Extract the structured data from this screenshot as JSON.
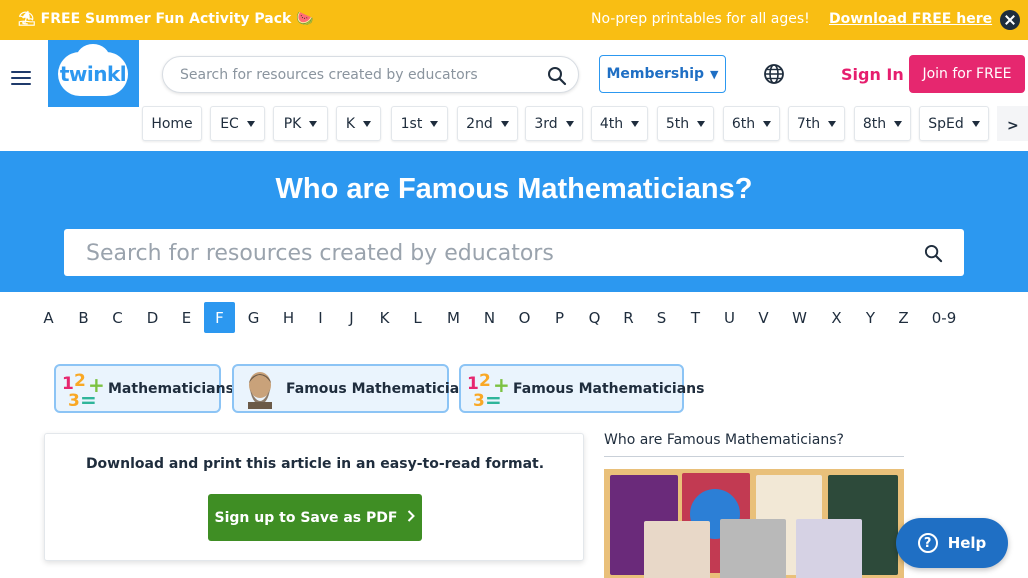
{
  "promo": {
    "headline": "FREE Summer Fun Activity Pack",
    "tagline": "No-prep printables for all ages!",
    "cta": "Download FREE here"
  },
  "header": {
    "logo_text": "twinkl",
    "search_placeholder": "Search for resources created by educators",
    "membership_label": "Membership",
    "sign_in": "Sign In",
    "join": "Join for FREE"
  },
  "nav": {
    "items": [
      {
        "label": "Home",
        "dropdown": false
      },
      {
        "label": "EC",
        "dropdown": true
      },
      {
        "label": "PK",
        "dropdown": true
      },
      {
        "label": "K",
        "dropdown": true
      },
      {
        "label": "1st",
        "dropdown": true
      },
      {
        "label": "2nd",
        "dropdown": true
      },
      {
        "label": "3rd",
        "dropdown": true
      },
      {
        "label": "4th",
        "dropdown": true
      },
      {
        "label": "5th",
        "dropdown": true
      },
      {
        "label": "6th",
        "dropdown": true
      },
      {
        "label": "7th",
        "dropdown": true
      },
      {
        "label": "8th",
        "dropdown": true
      },
      {
        "label": "SpEd",
        "dropdown": true
      }
    ],
    "more": ">"
  },
  "hero": {
    "title": "Who are Famous Mathematicians?",
    "search_placeholder": "Search for resources created by educators"
  },
  "alphabet": {
    "letters": [
      "A",
      "B",
      "C",
      "D",
      "E",
      "F",
      "G",
      "H",
      "I",
      "J",
      "K",
      "L",
      "M",
      "N",
      "O",
      "P",
      "Q",
      "R",
      "S",
      "T",
      "U",
      "V",
      "W",
      "X",
      "Y",
      "Z",
      "0-9"
    ],
    "active": "F"
  },
  "tags": [
    {
      "label": "Mathematicians",
      "icon": "numbers-icon"
    },
    {
      "label": "Famous Mathematician",
      "icon": "mathematician-portrait-icon"
    },
    {
      "label": "Famous Mathematicians",
      "icon": "numbers-icon"
    }
  ],
  "article": {
    "message": "Download and print this article in an easy-to-read format.",
    "pdf_button": "Sign up to Save as PDF"
  },
  "sidebar": {
    "title": "Who are Famous Mathematicians?"
  },
  "help": {
    "label": "Help"
  },
  "colors": {
    "promo_bg": "#f9be13",
    "brand_blue": "#2c98f0",
    "sign_in_pink": "#e61e6e",
    "join_pink": "#e6276f",
    "pdf_green": "#3f8e24",
    "help_blue": "#1f6fc4"
  }
}
